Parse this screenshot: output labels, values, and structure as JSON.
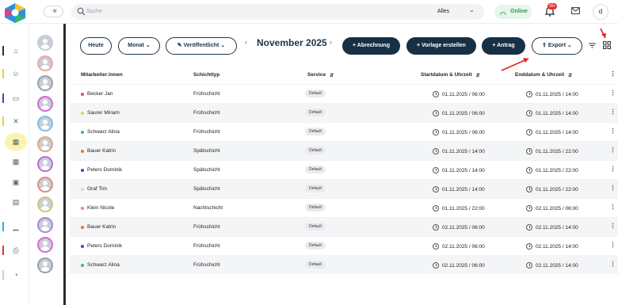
{
  "search": {
    "placeholder": "Suche",
    "scope": "Alles"
  },
  "status": {
    "label": "Online",
    "color": "#2e9d4b"
  },
  "notifications": {
    "badge": "99+"
  },
  "user": {
    "initial": "d"
  },
  "toolbar": {
    "today": "Heute",
    "period": "Monat",
    "published": "Veröffentlicht",
    "month": "November 2025",
    "billing": "Abrechnung",
    "create_template": "Vorlage erstellen",
    "request": "Antrag",
    "export": "Export"
  },
  "table": {
    "headers": {
      "employee": "Mitarbeiter:innen",
      "shift_type": "Schichttyp",
      "service": "Service",
      "start": "Startdatum & Uhrzeit",
      "end": "Enddatum & Uhrzeit"
    },
    "rows": [
      {
        "name": "Becker Jan",
        "dot": "#e05555",
        "type": "Frühschicht",
        "service": "Default",
        "start": "01.11.2025 / 06:00",
        "end": "01.11.2025 / 14:00"
      },
      {
        "name": "Saurer Miriam",
        "dot": "#e8d24a",
        "type": "Frühschicht",
        "service": "Default",
        "start": "01.11.2025 / 06:00",
        "end": "01.11.2025 / 14:00"
      },
      {
        "name": "Schwarz Alina",
        "dot": "#3fbf6a",
        "type": "Frühschicht",
        "service": "Default",
        "start": "01.11.2025 / 06:00",
        "end": "01.11.2025 / 14:00"
      },
      {
        "name": "Bauer Katrin",
        "dot": "#e07a30",
        "type": "Spätschicht",
        "service": "Default",
        "start": "01.11.2025 / 14:00",
        "end": "01.11.2025 / 22:00"
      },
      {
        "name": "Peters Dominik",
        "dot": "#3b4bc8",
        "type": "Spätschicht",
        "service": "Default",
        "start": "01.11.2025 / 14:00",
        "end": "01.11.2025 / 22:00"
      },
      {
        "name": "Graf Tim",
        "dot": "#d9d9d9",
        "type": "Spätschicht",
        "service": "Default",
        "start": "01.11.2025 / 14:00",
        "end": "01.11.2025 / 22:00"
      },
      {
        "name": "Klein Nicole",
        "dot": "#f07aa0",
        "type": "Nachtschicht",
        "service": "Default",
        "start": "01.11.2025 / 22:00",
        "end": "02.11.2025 / 06:00"
      },
      {
        "name": "Bauer Katrin",
        "dot": "#e07a30",
        "type": "Frühschicht",
        "service": "Default",
        "start": "02.11.2025 / 06:00",
        "end": "02.11.2025 / 14:00"
      },
      {
        "name": "Peters Dominik",
        "dot": "#3b4bc8",
        "type": "Frühschicht",
        "service": "Default",
        "start": "02.11.2025 / 06:00",
        "end": "02.11.2025 / 14:00"
      },
      {
        "name": "Schwarz Alina",
        "dot": "#3fbf6a",
        "type": "Frühschicht",
        "service": "Default",
        "start": "02.11.2025 / 06:00",
        "end": "02.11.2025 / 14:00"
      }
    ]
  },
  "sidebar": {
    "items": [
      {
        "icon": "home-icon",
        "accent": "#1e3347"
      },
      {
        "icon": "smiley-icon",
        "accent": "#e5d23a"
      },
      {
        "icon": "book-icon",
        "accent": "#3b4bc8"
      },
      {
        "icon": "shuffle-icon",
        "accent": "#e5d23a"
      },
      {
        "icon": "calendar-icon",
        "accent": ""
      },
      {
        "icon": "calendar-grid-icon",
        "accent": ""
      },
      {
        "icon": "calendar-check-icon",
        "accent": ""
      },
      {
        "icon": "calendar-list-icon",
        "accent": ""
      },
      {
        "icon": "chart-icon",
        "accent": "#29b6d8"
      },
      {
        "icon": "print-icon",
        "accent": "#e23131"
      },
      {
        "icon": "settings-icon",
        "accent": "#c8ced6"
      }
    ]
  },
  "people_avatars": [
    {
      "ring": "#c8ced6"
    },
    {
      "ring": "#f0a6a6"
    },
    {
      "ring": "#9aa2ab"
    },
    {
      "ring": "#d86ad1"
    },
    {
      "ring": "#7fc1e6"
    },
    {
      "ring": "#e6a67f"
    },
    {
      "ring": "#c46ad8"
    },
    {
      "ring": "#e58a8a"
    },
    {
      "ring": "#d6c27f"
    },
    {
      "ring": "#a88ad8"
    },
    {
      "ring": "#d86ad1"
    },
    {
      "ring": "#9aa2ab"
    }
  ]
}
